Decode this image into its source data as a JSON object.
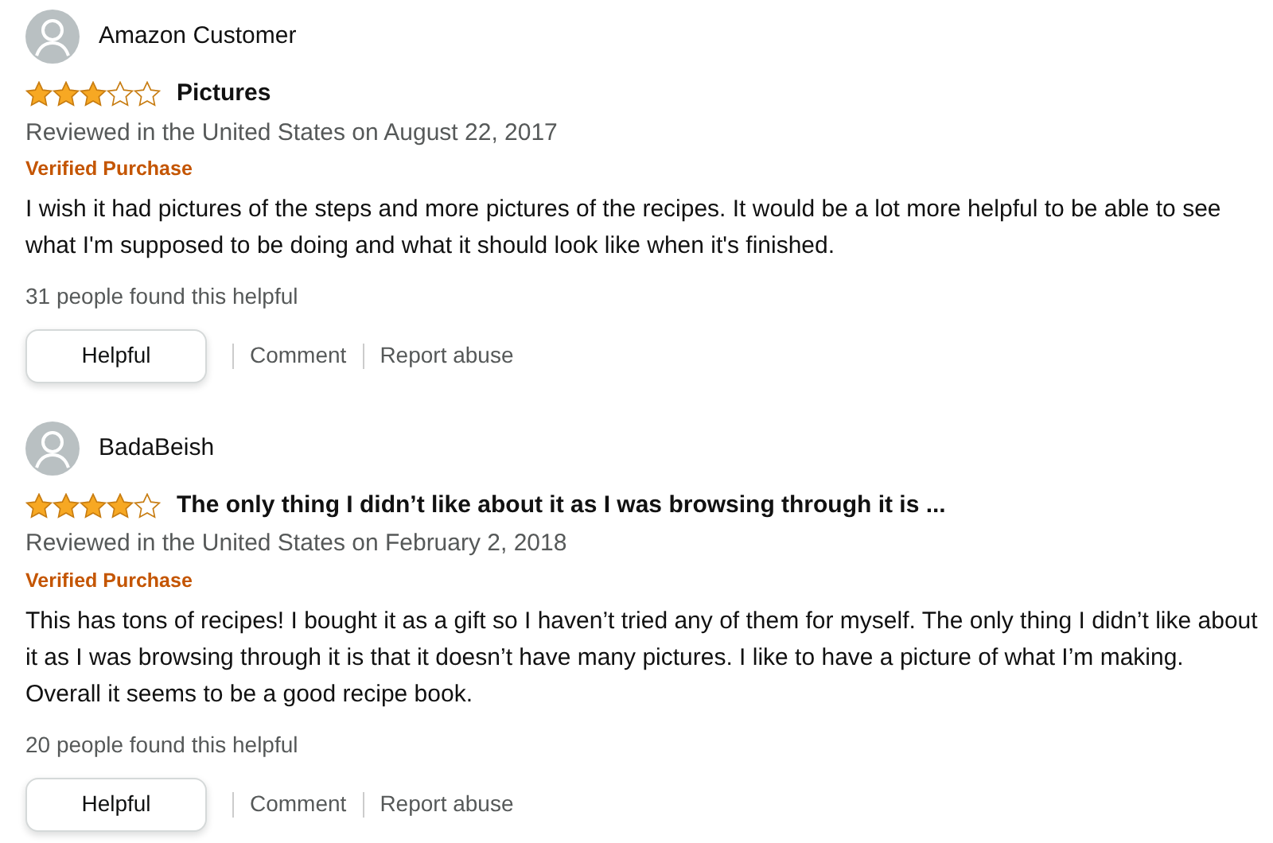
{
  "reviews": [
    {
      "author": "Amazon Customer",
      "stars": 3,
      "title": "Pictures",
      "date": "Reviewed in the United States on August 22, 2017",
      "badge": "Verified Purchase",
      "body": "I wish it had pictures of the steps and more pictures of the recipes. It would be a lot more helpful to be able to see what I'm supposed to be doing and what it should look like when it's finished.",
      "helpful_count": "31 people found this helpful",
      "actions": [
        "Helpful",
        "Comment",
        "Report abuse"
      ]
    },
    {
      "author": "BadaBeish",
      "stars": 4,
      "title": "The only thing I didn’t like about it as I was browsing through it is ...",
      "date": "Reviewed in the United States on February 2, 2018",
      "badge": "Verified Purchase",
      "body": "This has tons of recipes! I bought it as a gift so I haven’t tried any of them for myself. The only thing I didn’t like about it as I was browsing through it is that it doesn’t have many pictures. I like to have a picture of what I’m making. Overall it seems to be a good recipe book.",
      "helpful_count": "20 people found this helpful",
      "actions": [
        "Helpful",
        "Comment",
        "Report abuse"
      ]
    }
  ]
}
